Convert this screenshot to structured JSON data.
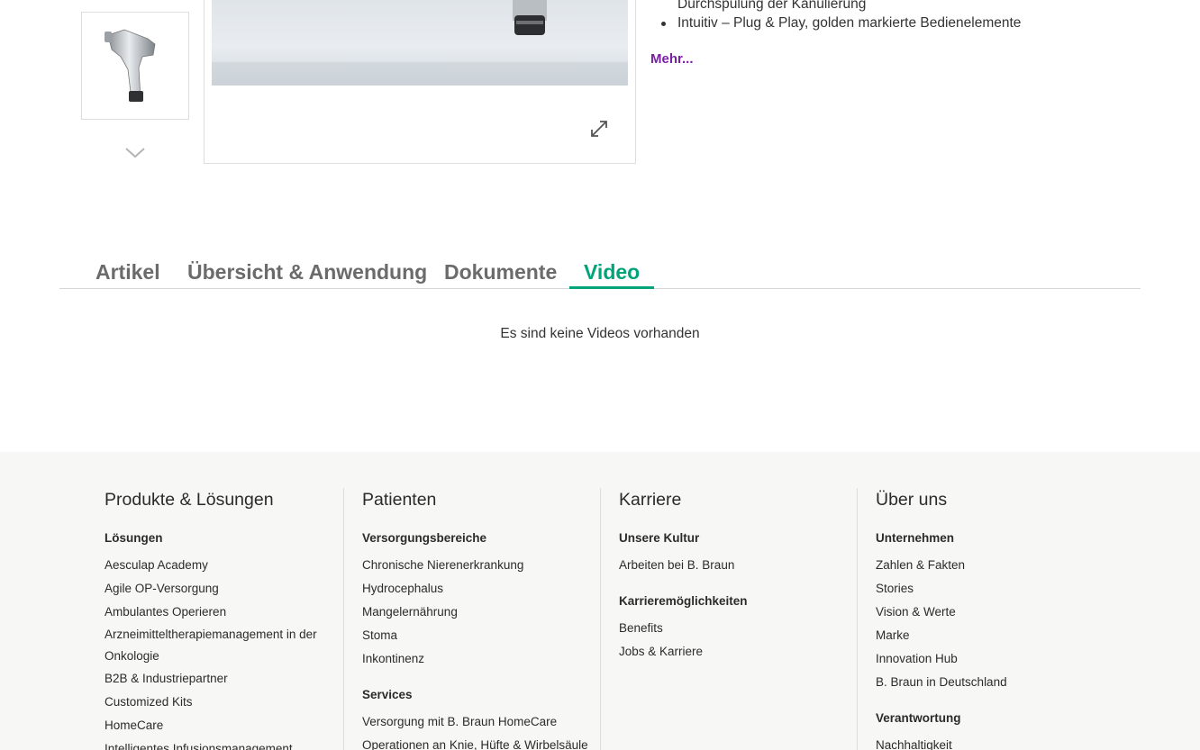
{
  "gallery": {
    "expand_hint": "expand-icon"
  },
  "features": {
    "items": [
      {
        "text": "Durchspülung der Kanülierung",
        "bullet": false
      },
      {
        "text": "Intuitiv – Plug & Play, golden markierte Bedienelemente",
        "bullet": true
      }
    ],
    "more_link": "Mehr..."
  },
  "tabs": [
    {
      "label": "Artikel",
      "active": false
    },
    {
      "label": "Übersicht & Anwendung",
      "active": false
    },
    {
      "label": "Dokumente",
      "active": false
    },
    {
      "label": "Video",
      "active": true
    }
  ],
  "video_panel": {
    "empty_text": "Es sind keine Videos vorhanden"
  },
  "colors": {
    "accent": "#00a37a",
    "link": "#7a1fa2",
    "footer_bg": "#f7f7f5"
  },
  "footer": {
    "columns": [
      {
        "title": "Produkte & Lösungen",
        "groups": [
          {
            "heading": "Lösungen",
            "links": [
              "Aesculap Academy",
              "Agile OP-Versorgung",
              "Ambulantes Operieren",
              "Arzneimitteltherapiemanagement in der Onkologie",
              "B2B & Industriepartner",
              "Customized Kits",
              "HomeCare",
              "Intelligentes Infusionsmanagement"
            ]
          }
        ]
      },
      {
        "title": "Patienten",
        "groups": [
          {
            "heading": "Versorgungsbereiche",
            "links": [
              "Chronische Nierenerkrankung",
              "Hydrocephalus",
              "Mangelernährung",
              "Stoma",
              "Inkontinenz"
            ]
          },
          {
            "heading": "Services",
            "links": [
              "Versorgung mit B. Braun HomeCare",
              "Operationen an Knie, Hüfte & Wirbelsäule"
            ]
          }
        ]
      },
      {
        "title": "Karriere",
        "groups": [
          {
            "heading": "Unsere Kultur",
            "links": [
              "Arbeiten bei B. Braun"
            ]
          },
          {
            "heading": "Karrieremöglichkeiten",
            "links": [
              "Benefits",
              "Jobs & Karriere"
            ]
          }
        ]
      },
      {
        "title": "Über uns",
        "groups": [
          {
            "heading": "Unternehmen",
            "links": [
              "Zahlen & Fakten",
              "Stories",
              "Vision & Werte",
              "Marke",
              "Innovation Hub",
              "B. Braun in Deutschland"
            ]
          },
          {
            "heading": "Verantwortung",
            "links": [
              "Nachhaltigkeit"
            ]
          }
        ]
      }
    ]
  }
}
